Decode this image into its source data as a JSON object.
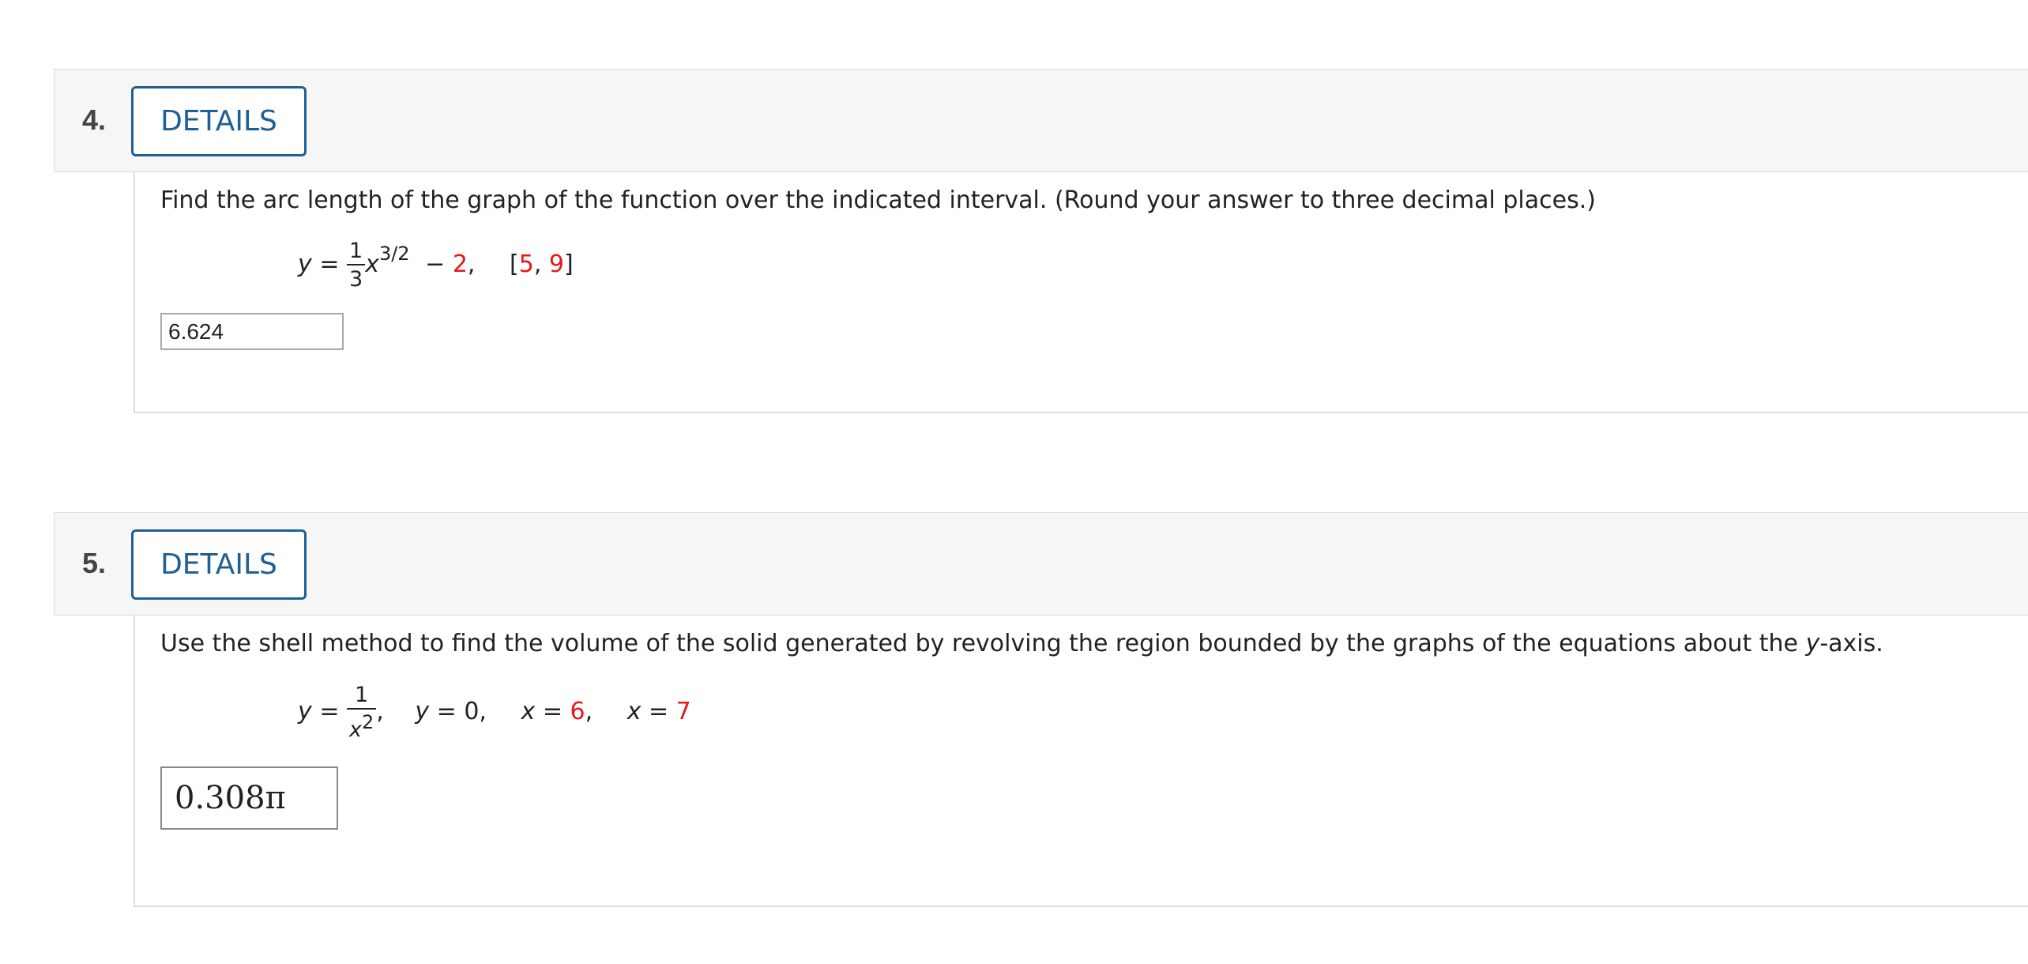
{
  "questions": [
    {
      "number": "4.",
      "details_label": "DETAILS",
      "prompt": "Find the arc length of the graph of the function over the indicated interval. (Round your answer to three decimal places.)",
      "equation": {
        "lhs": "y",
        "eq": "=",
        "frac_num": "1",
        "frac_den": "3",
        "x": "x",
        "exp": "3/2",
        "minus": "−",
        "const": "2",
        "comma": ",",
        "interval_open": "[",
        "interval_a": "5",
        "interval_sep": ",",
        "interval_b": "9",
        "interval_close": "]"
      },
      "answer": "6.624"
    },
    {
      "number": "5.",
      "details_label": "DETAILS",
      "prompt_before": "Use the shell method to find the volume of the solid generated by revolving the region bounded by the graphs of the equations about the ",
      "prompt_var": "y",
      "prompt_after": "-axis.",
      "equation": {
        "lhs": "y",
        "eq": "=",
        "frac_num": "1",
        "frac_den_var": "x",
        "frac_den_exp": "2",
        "comma1": ",",
        "eq2_var": "y",
        "eq2_rest": " = 0,",
        "eq3_var": "x",
        "eq3_eq": " = ",
        "eq3_val": "6",
        "eq3_comma": ",",
        "eq4_var": "x",
        "eq4_eq": " = ",
        "eq4_val": "7"
      },
      "answer": "0.308π"
    }
  ],
  "colors": {
    "accent": "#1f5f93",
    "highlight_red": "#e8161b",
    "header_bg": "#f6f6f6"
  }
}
